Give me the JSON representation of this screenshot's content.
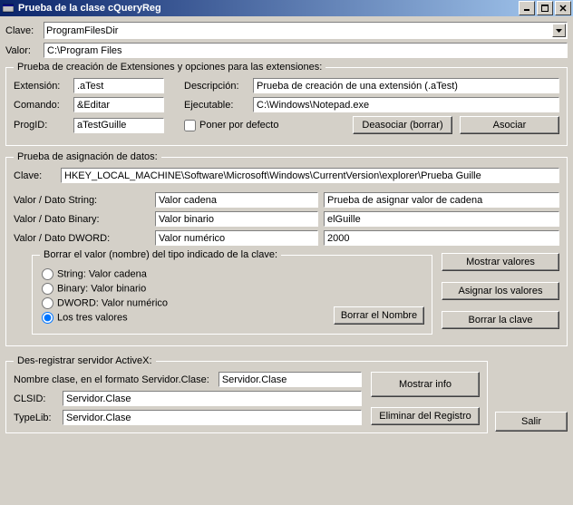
{
  "window": {
    "title": "Prueba de la clase cQueryReg"
  },
  "top": {
    "clave_label": "Clave:",
    "clave_value": "ProgramFilesDir",
    "valor_label": "Valor:",
    "valor_value": "C:\\Program Files"
  },
  "ext": {
    "legend": "Prueba de creación de Extensiones y opciones para las extensiones:",
    "extension_label": "Extensión:",
    "extension_value": ".aTest",
    "descripcion_label": "Descripción:",
    "descripcion_value": "Prueba de creación de una extensión (.aTest)",
    "comando_label": "Comando:",
    "comando_value": "&Editar",
    "ejecutable_label": "Ejecutable:",
    "ejecutable_value": "C:\\Windows\\Notepad.exe",
    "progid_label": "ProgID:",
    "progid_value": "aTestGuille",
    "poner_defecto_label": "Poner por defecto",
    "btn_deasociar": "Deasociar (borrar)",
    "btn_asociar": "Asociar"
  },
  "asig": {
    "legend": "Prueba de asignación de datos:",
    "clave_label": "Clave:",
    "clave_value": "HKEY_LOCAL_MACHINE\\Software\\Microsoft\\Windows\\CurrentVersion\\explorer\\Prueba Guille",
    "string_label": "Valor / Dato String:",
    "string_v1": "Valor cadena",
    "string_v2": "Prueba de asignar valor de cadena",
    "binary_label": "Valor / Dato Binary:",
    "binary_v1": "Valor binario",
    "binary_v2": "elGuille",
    "dword_label": "Valor / Dato DWORD:",
    "dword_v1": "Valor numérico",
    "dword_v2": "2000",
    "borrar_legend": "Borrar el valor (nombre) del tipo indicado de la clave:",
    "rad_string": "String: Valor cadena",
    "rad_binary": "Binary: Valor binario",
    "rad_dword": "DWORD: Valor numérico",
    "rad_all": "Los tres valores",
    "btn_borrar_nombre": "Borrar el Nombre",
    "btn_mostrar": "Mostrar valores",
    "btn_asignar": "Asignar los valores",
    "btn_borrar_clave": "Borrar la clave"
  },
  "desreg": {
    "legend": "Des-registrar servidor ActiveX:",
    "nombre_label": "Nombre clase, en el formato Servidor.Clase:",
    "nombre_value": "Servidor.Clase",
    "clsid_label": "CLSID:",
    "clsid_value": "Servidor.Clase",
    "typelib_label": "TypeLib:",
    "typelib_value": "Servidor.Clase",
    "btn_mostrar_info": "Mostrar info",
    "btn_eliminar": "Eliminar del Registro"
  },
  "footer": {
    "btn_salir": "Salir"
  }
}
